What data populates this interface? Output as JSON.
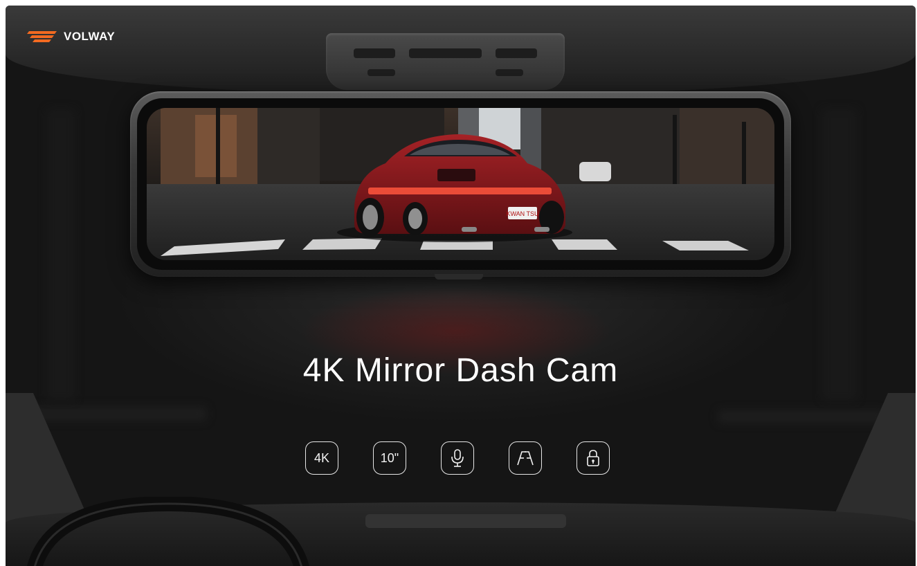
{
  "brand": {
    "name": "VOLWAY",
    "accent_color": "#f26a21",
    "logo_icon": "speed-stripes-logo"
  },
  "hero": {
    "headline": "4K Mirror Dash Cam"
  },
  "mirror_display": {
    "license_plate": "KWAN TSU",
    "car_color": "#8e1a1d"
  },
  "features": [
    {
      "id": "4k",
      "label": "4K",
      "icon": "4k-badge-icon"
    },
    {
      "id": "screen",
      "label": "10\"",
      "icon": "screen-size-icon"
    },
    {
      "id": "audio",
      "label": "",
      "icon": "microphone-icon"
    },
    {
      "id": "lane",
      "label": "",
      "icon": "lane-assist-icon"
    },
    {
      "id": "lock",
      "label": "",
      "icon": "lock-icon"
    }
  ]
}
